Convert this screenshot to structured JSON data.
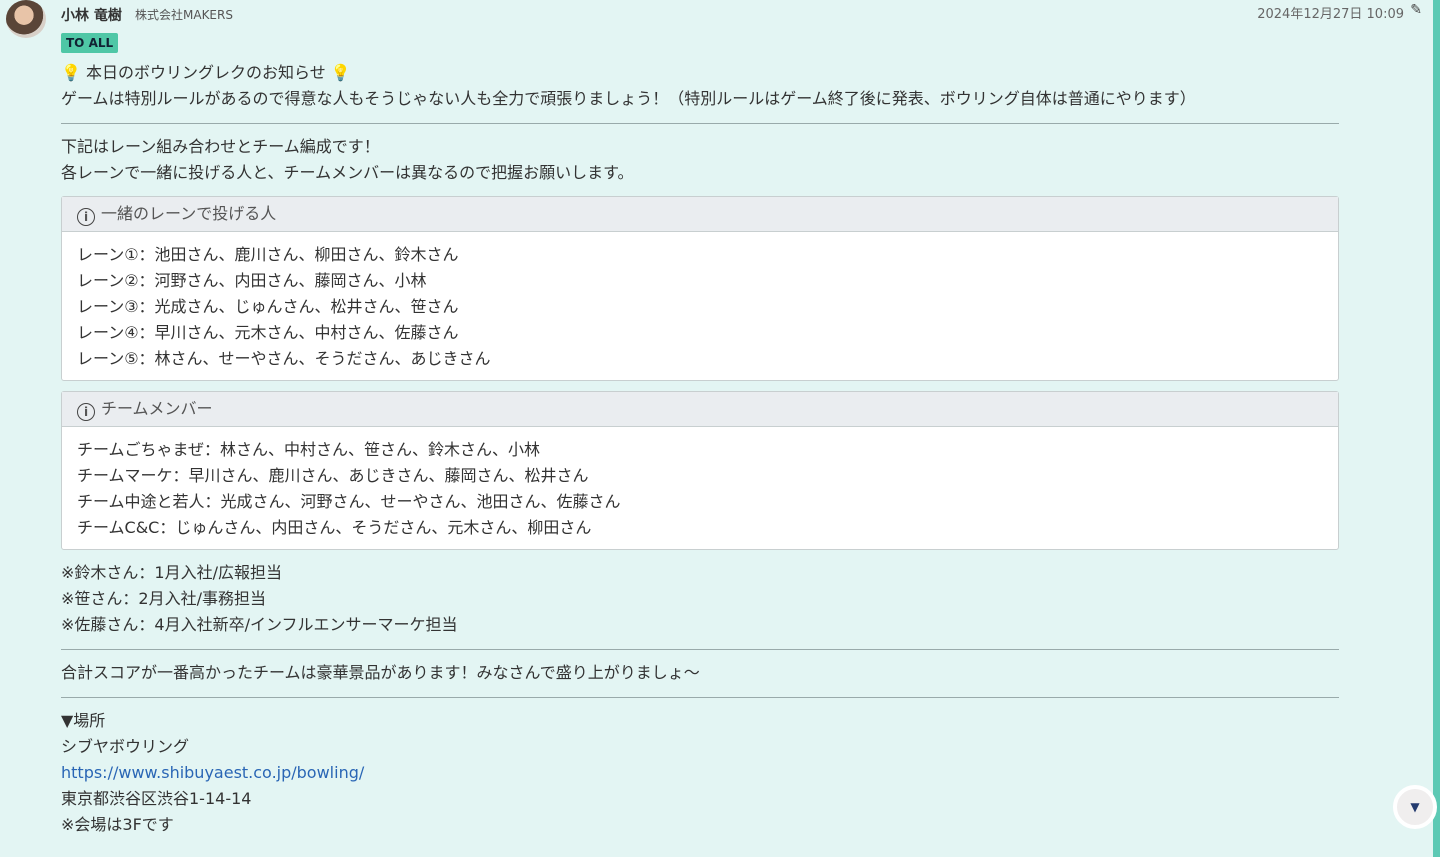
{
  "header": {
    "author": "小林 竜樹",
    "company": "株式会社MAKERS",
    "timestamp": "2024年12月27日 10:09",
    "badge": "TO ALL"
  },
  "message": {
    "title": "本日のボウリングレクのお知らせ",
    "intro": "ゲームは特別ルールがあるので得意な人もそうじゃない人も全力で頑張りましょう！（特別ルールはゲーム終了後に発表、ボウリング自体は普通にやります）",
    "lead": [
      "下記はレーン組み合わせとチーム編成です！",
      "各レーンで一緒に投げる人と、チームメンバーは異なるので把握お願いします。"
    ],
    "lanes": {
      "title": "一緒のレーンで投げる人",
      "items": [
        "レーン①：池田さん、鹿川さん、柳田さん、鈴木さん",
        "レーン②：河野さん、内田さん、藤岡さん、小林",
        "レーン③：光成さん、じゅんさん、松井さん、笹さん",
        "レーン④：早川さん、元木さん、中村さん、佐藤さん",
        "レーン⑤：林さん、せーやさん、そうださん、あじきさん"
      ]
    },
    "teams": {
      "title": "チームメンバー",
      "items": [
        "チームごちゃまぜ：林さん、中村さん、笹さん、鈴木さん、小林",
        "チームマーケ：早川さん、鹿川さん、あじきさん、藤岡さん、松井さん",
        "チーム中途と若人：光成さん、河野さん、せーやさん、池田さん、佐藤さん",
        "チームC&C：じゅんさん、内田さん、そうださん、元木さん、柳田さん"
      ]
    },
    "notes": [
      "※鈴木さん：1月入社/広報担当",
      "※笹さん：2月入社/事務担当",
      "※佐藤さん：4月入社新卒/インフルエンサーマーケ担当"
    ],
    "prize": "合計スコアが一番高かったチームは豪華景品があります！みなさんで盛り上がりましょ〜",
    "venue": {
      "heading": "▼場所",
      "name": "シブヤボウリング",
      "url": "https://www.shibuyaest.co.jp/bowling/",
      "address": "東京都渋谷区渋谷1-14-14",
      "note": "※会場は3Fです"
    }
  },
  "icons": {
    "bulb": "💡",
    "info": "i",
    "edit": "✎",
    "scroll": "▼"
  }
}
